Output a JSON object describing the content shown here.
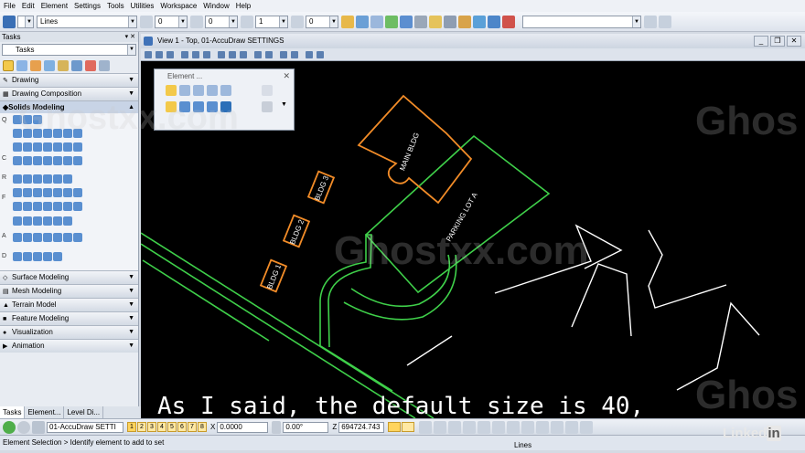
{
  "menu": [
    "File",
    "Edit",
    "Element",
    "Settings",
    "Tools",
    "Utilities",
    "Workspace",
    "Window",
    "Help"
  ],
  "toolbar": {
    "level_value": "",
    "style_value": "Lines",
    "color_value": "0",
    "weight_value": "0",
    "priority_value": "1",
    "transparency_value": "0"
  },
  "tasks": {
    "title": "Tasks",
    "combo_value": "Tasks",
    "sections": [
      "Drawing",
      "Drawing Composition",
      "Solids Modeling",
      "Surface Modeling",
      "Mesh Modeling",
      "Terrain Model",
      "Feature Modeling",
      "Visualization",
      "Animation"
    ],
    "side_letters": [
      "Q",
      "C",
      "R",
      "F",
      "A",
      "D"
    ]
  },
  "view": {
    "title": "View 1 - Top, 01-AccuDraw SETTINGS",
    "controls": [
      "_",
      "❐",
      "✕"
    ]
  },
  "drawing_labels": {
    "main_bldg": "MAIN BLDG",
    "parking": "PARKING LOT A",
    "bldg1": "BLDG 1",
    "bldg2": "BLDG 2",
    "bldg3": "BLDG 3"
  },
  "element_dialog": {
    "title": "Element ...",
    "close": "✕"
  },
  "bottom_tabs": [
    "Tasks",
    "Element...",
    "Level Di..."
  ],
  "accudraw": {
    "model": "01-AccuDraw SETTI",
    "view_buttons": [
      "1",
      "2",
      "3",
      "4",
      "5",
      "6",
      "7",
      "8"
    ],
    "x_label": "X",
    "x_value": "0.0000",
    "angle_value": "0.00°",
    "z_label": "Z",
    "z_value": "694724.743"
  },
  "status": {
    "prompt": "Element Selection > Identify element to add to set",
    "level": "Lines"
  },
  "subtitle": "As I said, the default size is 40,",
  "watermark": "Ghostxx.com",
  "watermark_short": "Ghos",
  "brand": {
    "word": "Linked",
    "suffix": "in"
  },
  "colors": {
    "building": "#f28c28",
    "road": "#3fd04a",
    "white_lines": "#ffffff",
    "canvas": "#000000"
  }
}
